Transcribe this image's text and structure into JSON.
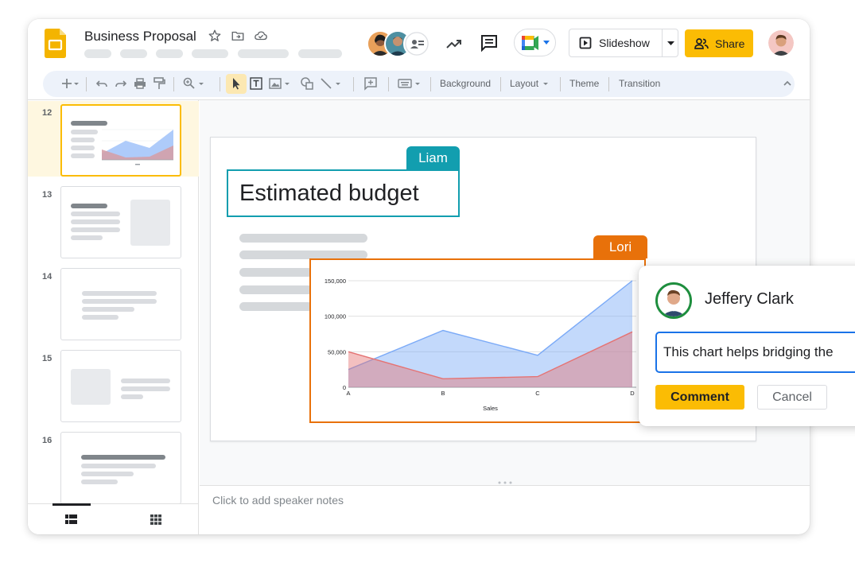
{
  "app": {
    "logo_icon": "slides-logo-icon",
    "document_title": "Business Proposal",
    "title_icons": [
      "star-icon",
      "move-to-folder-icon",
      "cloud-saved-icon"
    ]
  },
  "header": {
    "collaborators": [
      "collaborator-avatar-1",
      "collaborator-avatar-2",
      "more-collaborators-icon"
    ],
    "activity_icon": "trending-up-icon",
    "comments_icon": "comment-icon",
    "meet_icon": "google-meet-icon",
    "slideshow_label": "Slideshow",
    "share_label": "Share",
    "accent_color": "#fbbc04"
  },
  "toolbar": {
    "background": "Background",
    "layout": "Layout",
    "theme": "Theme",
    "transition": "Transition"
  },
  "slides": [
    {
      "number": "12",
      "selected": true
    },
    {
      "number": "13"
    },
    {
      "number": "14"
    },
    {
      "number": "15"
    },
    {
      "number": "16"
    }
  ],
  "slide": {
    "title": "Estimated budget",
    "collab_tags": [
      {
        "name": "Liam",
        "color": "#129eaf"
      },
      {
        "name": "Lori",
        "color": "#e8710a"
      }
    ]
  },
  "chart_data": {
    "type": "area",
    "categories": [
      "A",
      "B",
      "C",
      "D"
    ],
    "series": [
      {
        "values": [
          25000,
          80000,
          45000,
          150000
        ],
        "color": "#7baaf7"
      },
      {
        "values": [
          50000,
          12000,
          15000,
          78000
        ],
        "color": "#e57373"
      }
    ],
    "xlabel": "Sales",
    "ylim": [
      0,
      150000
    ],
    "yticks": [
      "0",
      "50,000",
      "100,000",
      "150,000"
    ],
    "grid": true
  },
  "notes": {
    "placeholder": "Click to add speaker notes"
  },
  "comment": {
    "author": "Jeffery Clark",
    "text": "This chart helps bridging the",
    "submit_label": "Comment",
    "cancel_label": "Cancel"
  }
}
